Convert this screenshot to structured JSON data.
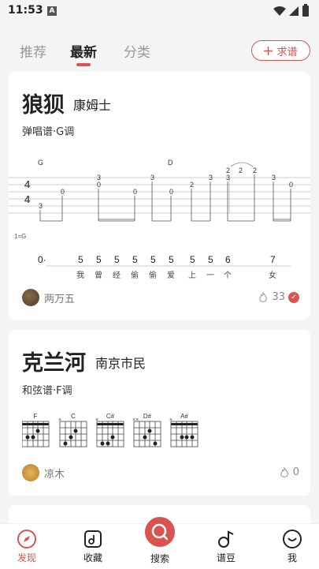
{
  "status": {
    "time": "11:53",
    "notif_icon": "A"
  },
  "tabs": [
    {
      "label": "推荐",
      "active": false
    },
    {
      "label": "最新",
      "active": true
    },
    {
      "label": "分类",
      "active": false
    }
  ],
  "ask_button": {
    "icon": "plus-icon",
    "label": "求谱"
  },
  "songs": [
    {
      "title": "狼狈",
      "artist": "康姆士",
      "type": "弹唱谱·G调",
      "tab": {
        "chord_labels": [
          "G",
          "D"
        ],
        "time_sig": [
          "4",
          "4"
        ],
        "key_label": "1=G",
        "notes": [
          "0·",
          "5",
          "5",
          "5",
          "5",
          "5",
          "5",
          "5",
          "5",
          "6",
          "7"
        ],
        "lyrics": [
          "我",
          "曾",
          "经",
          "偷",
          "偷",
          "爱",
          "上",
          "一",
          "个",
          "女"
        ],
        "fret_numbers": [
          "3",
          "0",
          "3",
          "0",
          "0",
          "3",
          "0",
          "2",
          "3",
          "2",
          "3",
          "2",
          "2",
          "3",
          "0",
          "0",
          "3",
          "0"
        ]
      },
      "author": "两万五",
      "likes": "33"
    },
    {
      "title": "克兰河",
      "artist": "南京市民",
      "type": "和弦谱·F调",
      "chords": [
        "F",
        "C",
        "C#",
        "D#",
        "A#"
      ],
      "author": "凉木",
      "likes": "0"
    }
  ],
  "nav": [
    {
      "label": "发现",
      "icon": "compass-icon",
      "active": true
    },
    {
      "label": "收藏",
      "icon": "music-note-box-icon",
      "active": false
    },
    {
      "label": "搜索",
      "icon": "search-icon",
      "active": false
    },
    {
      "label": "谱豆",
      "icon": "music-note-icon",
      "active": false
    },
    {
      "label": "我",
      "icon": "face-icon",
      "active": false
    }
  ],
  "colors": {
    "accent": "#d9534f",
    "background": "#f4f4f4"
  }
}
